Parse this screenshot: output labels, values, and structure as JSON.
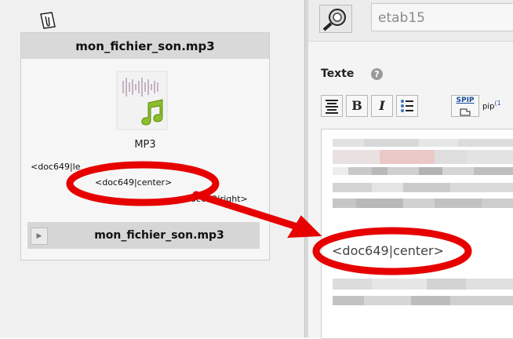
{
  "document_panel": {
    "title": "mon_fichier_son.mp3",
    "file_type_label": "MP3",
    "code_left": "<doc649|le",
    "code_center": "<doc649|center>",
    "code_right": "<doc649|right>",
    "mini_title": "mon_fichier_son.mp3",
    "toggle_icon": "▶"
  },
  "editor": {
    "search_value": "etab15",
    "text_label": "Texte",
    "help_icon_char": "?",
    "toolbar": {
      "bold": "B",
      "italic": "I",
      "spip": "SPIP",
      "extra": "pip",
      "extra_sup": "(1"
    },
    "inserted_code": "<doc649|center>"
  },
  "icons": [
    "paperclip-icon",
    "audio-file-icon",
    "search-icon",
    "help-icon",
    "align-icon",
    "list-icon",
    "spip-icon"
  ],
  "colors": {
    "annotation": "#e60000",
    "link_blue": "#1a4d9c",
    "header_gray": "#d9d9d9"
  }
}
